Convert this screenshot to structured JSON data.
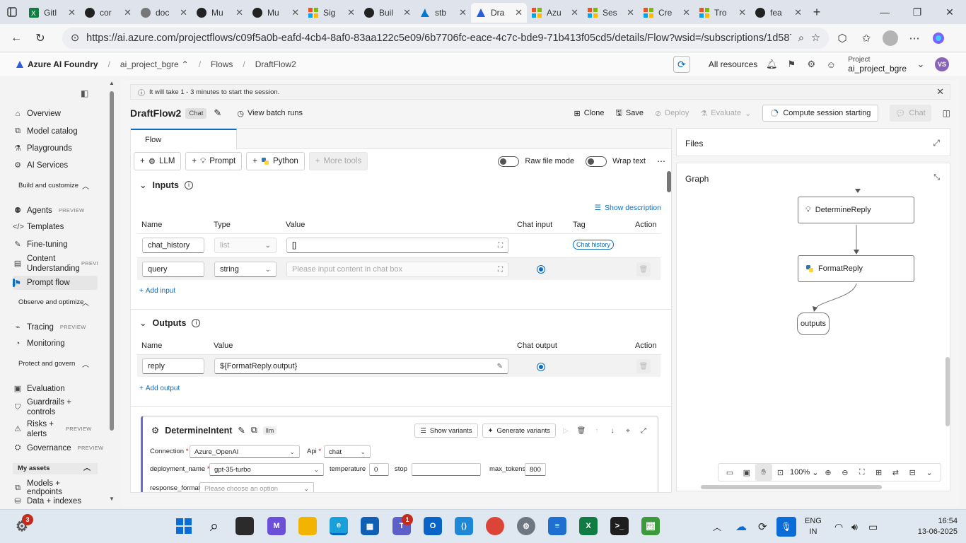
{
  "browser": {
    "tabs": [
      {
        "label": "Gitl",
        "icon": "excel-icon"
      },
      {
        "label": "cor",
        "icon": "github-icon"
      },
      {
        "label": "doc",
        "icon": "globe-icon"
      },
      {
        "label": "Mu",
        "icon": "github-icon"
      },
      {
        "label": "Mu",
        "icon": "github-icon"
      },
      {
        "label": "Sig",
        "icon": "microsoft-icon"
      },
      {
        "label": "Buil",
        "icon": "github-icon"
      },
      {
        "label": "stb",
        "icon": "azure-icon"
      },
      {
        "label": "Dra",
        "icon": "foundry-icon",
        "active": true
      },
      {
        "label": "Azu",
        "icon": "microsoft-icon"
      },
      {
        "label": "Ses",
        "icon": "microsoft-icon"
      },
      {
        "label": "Cre",
        "icon": "microsoft-icon"
      },
      {
        "label": "Tro",
        "icon": "microsoft-icon"
      },
      {
        "label": "fea",
        "icon": "github-icon"
      }
    ],
    "url": "https://ai.azure.com/projectflows/c09f5a0b-eafd-4cb4-8af0-83aa122c5e09/6b7706fc-eace-4c7c-bde9-71b413f05cd5/details/Flow?wsid=/subscriptions/1d587..."
  },
  "header": {
    "brand": "Azure AI Foundry",
    "breadcrumbs": [
      "ai_project_bgre",
      "Flows",
      "DraftFlow2"
    ],
    "all_resources": "All resources",
    "project_label": "Project",
    "project_name": "ai_project_bgre",
    "avatar_initials": "VS"
  },
  "sidebar": {
    "items": [
      {
        "label": "Overview",
        "icon": "home-icon"
      },
      {
        "label": "Model catalog",
        "icon": "cube-icon"
      },
      {
        "label": "Playgrounds",
        "icon": "playground-icon"
      },
      {
        "label": "AI Services",
        "icon": "services-icon"
      }
    ],
    "sections": [
      {
        "title": "Build and customize"
      },
      {
        "title": "Observe and optimize"
      },
      {
        "title": "Protect and govern"
      },
      {
        "title": "My assets"
      }
    ],
    "build_items": [
      {
        "label": "Agents",
        "preview": "PREVIEW"
      },
      {
        "label": "Templates",
        "preview": ""
      },
      {
        "label": "Fine-tuning",
        "preview": ""
      },
      {
        "label": "Content Understanding",
        "preview": "PREVI"
      },
      {
        "label": "Prompt flow",
        "preview": "",
        "selected": true
      }
    ],
    "observe_items": [
      {
        "label": "Tracing",
        "preview": "PREVIEW"
      },
      {
        "label": "Monitoring",
        "preview": ""
      }
    ],
    "protect_items": [
      {
        "label": "Evaluation",
        "preview": ""
      },
      {
        "label": "Guardrails + controls",
        "preview": ""
      },
      {
        "label": "Risks + alerts",
        "preview": "PREVIEW"
      },
      {
        "label": "Governance",
        "preview": "PREVIEW"
      }
    ],
    "asset_items": [
      {
        "label": "Models + endpoints"
      },
      {
        "label": "Data + indexes"
      }
    ]
  },
  "notice": "It will take 1 - 3 minutes to start the session.",
  "flow": {
    "name": "DraftFlow2",
    "type_chip": "Chat",
    "view_batch_runs": "View batch runs",
    "clone": "Clone",
    "save": "Save",
    "deploy": "Deploy",
    "evaluate": "Evaluate",
    "session": "Compute session starting",
    "chat": "Chat",
    "tab": "Flow",
    "tools": {
      "llm": "LLM",
      "prompt": "Prompt",
      "python": "Python",
      "more": "More tools"
    },
    "raw_file_mode": "Raw file mode",
    "wrap_text": "Wrap text"
  },
  "inputs": {
    "title": "Inputs",
    "show_description": "Show description",
    "headers": {
      "name": "Name",
      "type": "Type",
      "value": "Value",
      "chat_input": "Chat input",
      "tag": "Tag",
      "action": "Action"
    },
    "rows": [
      {
        "name": "chat_history",
        "type": "list",
        "value": "[]",
        "tag": "Chat history"
      },
      {
        "name": "query",
        "type": "string",
        "placeholder": "Please input content in chat box"
      }
    ],
    "add": "Add input"
  },
  "outputs": {
    "title": "Outputs",
    "headers": {
      "name": "Name",
      "value": "Value",
      "chat_output": "Chat output",
      "action": "Action"
    },
    "rows": [
      {
        "name": "reply",
        "value": "${FormatReply.output}"
      }
    ],
    "add": "Add output"
  },
  "node": {
    "name": "DetermineIntent",
    "tag": "llm",
    "show_variants": "Show variants",
    "generate_variants": "Generate variants",
    "connection_label": "Connection",
    "connection": "Azure_OpenAI",
    "api_label": "Api",
    "api": "chat",
    "deployment_label": "deployment_name",
    "deployment": "gpt-35-turbo",
    "temperature_label": "temperature",
    "temperature": "0",
    "stop_label": "stop",
    "max_tokens_label": "max_tokens",
    "max_tokens": "800",
    "response_format_label": "response_format",
    "response_format_placeholder": "Please choose an option"
  },
  "files": {
    "title": "Files"
  },
  "graph": {
    "title": "Graph",
    "nodes": [
      "DetermineReply",
      "FormatReply"
    ],
    "output_node": "outputs",
    "zoom": "100%"
  },
  "taskbar": {
    "teams_badge": "1",
    "notif_badge": "3",
    "lang_line1": "ENG",
    "lang_line2": "IN",
    "time": "16:54",
    "date": "13-06-2025"
  }
}
